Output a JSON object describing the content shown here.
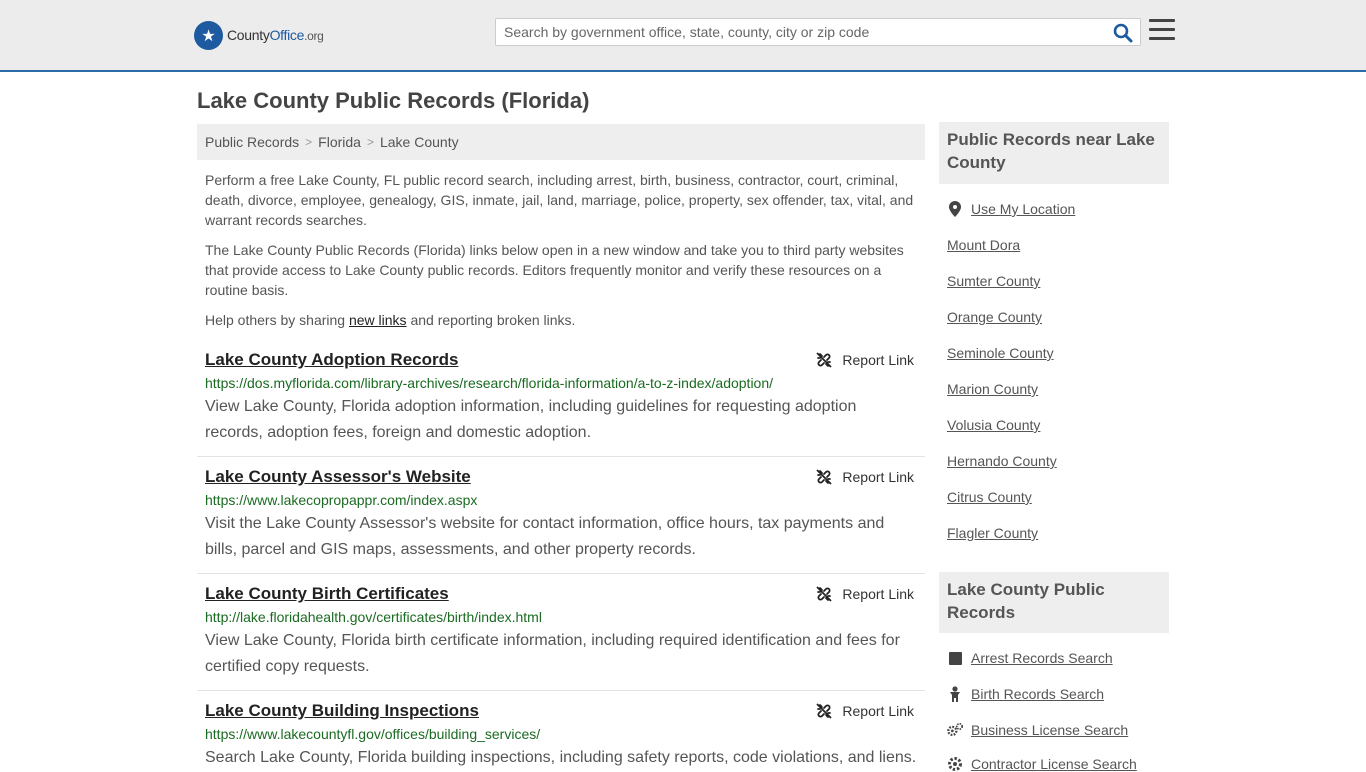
{
  "header": {
    "logo": {
      "part1": "County",
      "part2": "Office",
      "part3": ".org"
    },
    "search_placeholder": "Search by government office, state, county, city or zip code"
  },
  "page_title": "Lake County Public Records (Florida)",
  "breadcrumb": [
    "Public Records",
    "Florida",
    "Lake County"
  ],
  "intro": {
    "p1": "Perform a free Lake County, FL public record search, including arrest, birth, business, contractor, court, criminal, death, divorce, employee, genealogy, GIS, inmate, jail, land, marriage, police, property, sex offender, tax, vital, and warrant records searches.",
    "p2": "The Lake County Public Records (Florida) links below open in a new window and take you to third party websites that provide access to Lake County public records. Editors frequently monitor and verify these resources on a routine basis.",
    "p3_before": "Help others by sharing ",
    "p3_link": "new links",
    "p3_after": " and reporting broken links."
  },
  "report_label": "Report Link",
  "records": [
    {
      "title": "Lake County Adoption Records",
      "url": "https://dos.myflorida.com/library-archives/research/florida-information/a-to-z-index/adoption/",
      "desc": "View Lake County, Florida adoption information, including guidelines for requesting adoption records, adoption fees, foreign and domestic adoption."
    },
    {
      "title": "Lake County Assessor's Website",
      "url": "https://www.lakecopropappr.com/index.aspx",
      "desc": "Visit the Lake County Assessor's website for contact information, office hours, tax payments and bills, parcel and GIS maps, assessments, and other property records."
    },
    {
      "title": "Lake County Birth Certificates",
      "url": "http://lake.floridahealth.gov/certificates/birth/index.html",
      "desc": "View Lake County, Florida birth certificate information, including required identification and fees for certified copy requests."
    },
    {
      "title": "Lake County Building Inspections",
      "url": "https://www.lakecountyfl.gov/offices/building_services/",
      "desc": "Search Lake County, Florida building inspections, including safety reports, code violations, and liens."
    }
  ],
  "sidebar": {
    "nearby_title": "Public Records near Lake County",
    "use_location": "Use My Location",
    "nearby": [
      "Mount Dora",
      "Sumter County",
      "Orange County",
      "Seminole County",
      "Marion County",
      "Volusia County",
      "Hernando County",
      "Citrus County",
      "Flagler County"
    ],
    "records_title": "Lake County Public Records",
    "record_links": [
      {
        "label": "Arrest Records Search",
        "icon": "square-icon"
      },
      {
        "label": "Birth Records Search",
        "icon": "baby-icon"
      },
      {
        "label": "Business License Search",
        "icon": "gears-icon"
      },
      {
        "label": "Contractor License Search",
        "icon": "gear-icon"
      }
    ]
  }
}
